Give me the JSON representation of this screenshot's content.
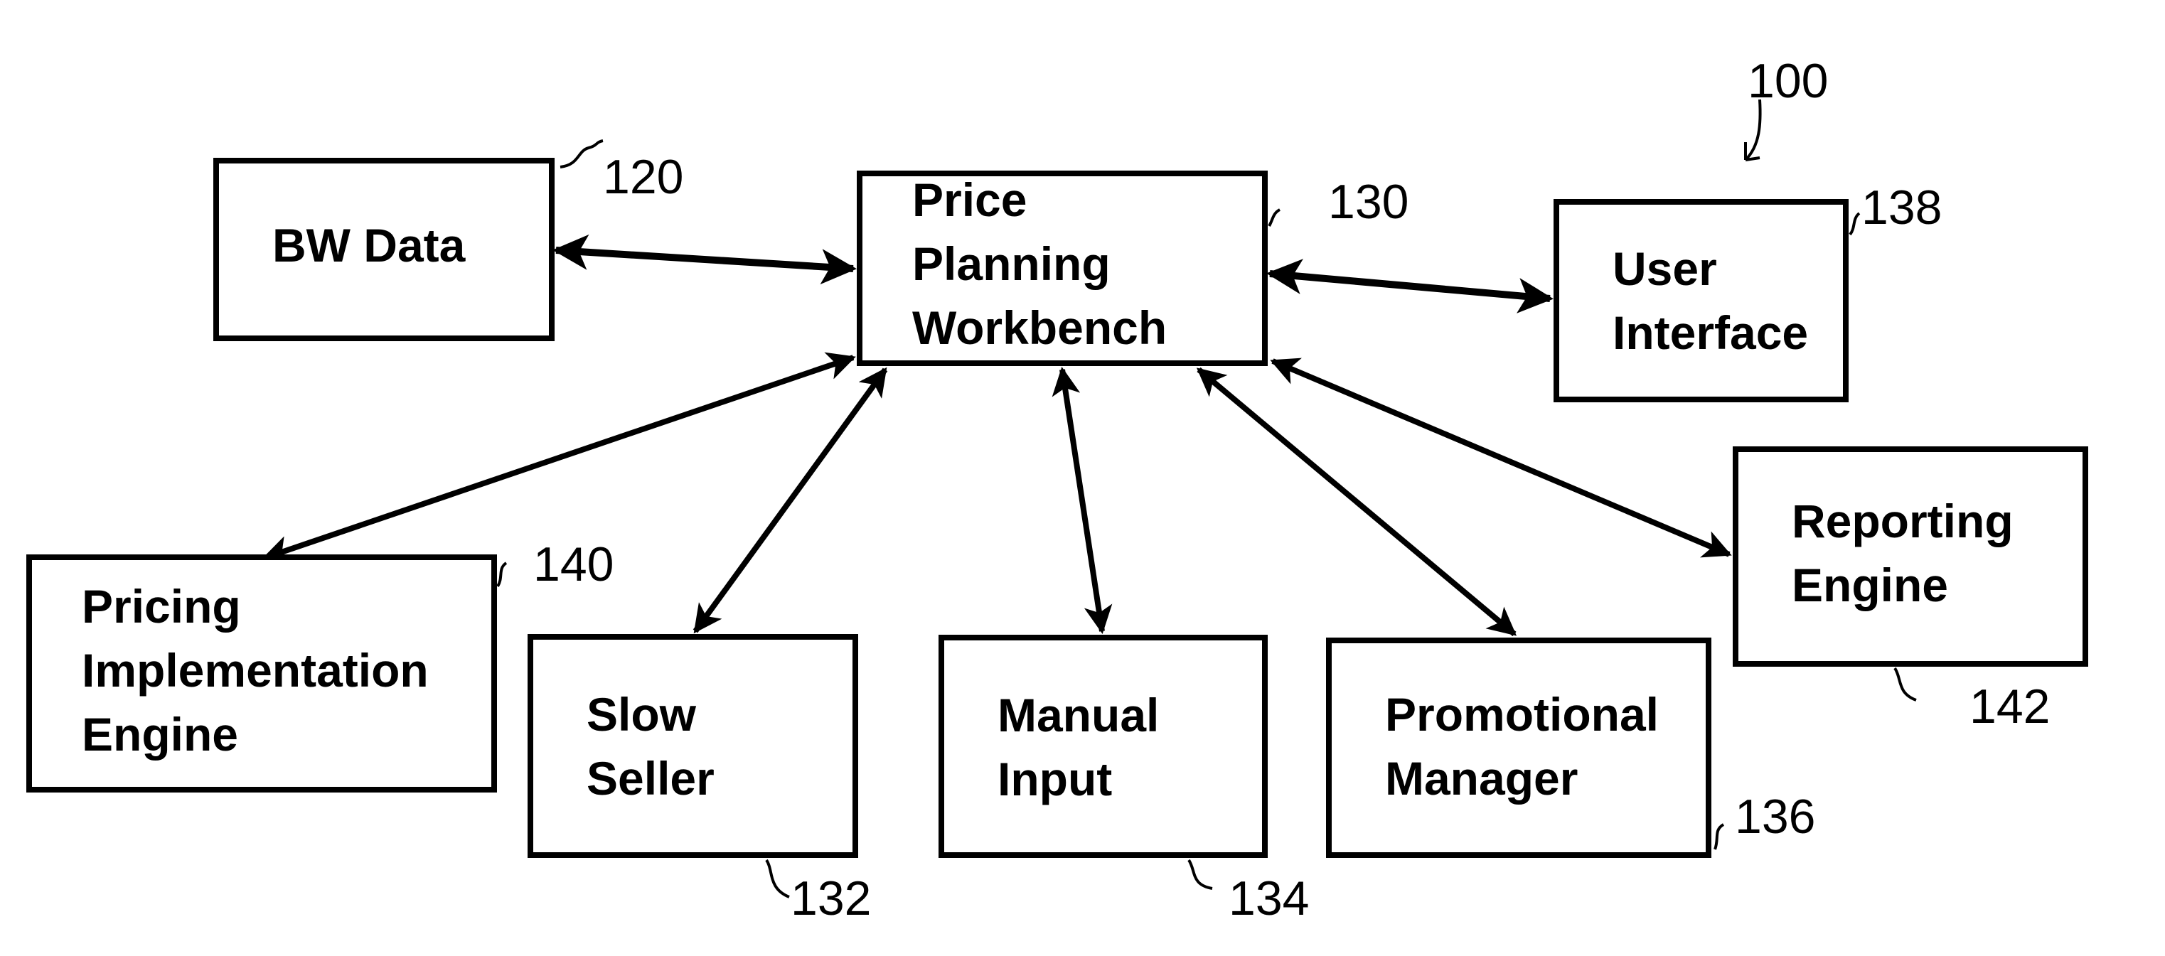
{
  "figure_ref": "100",
  "nodes": {
    "bw_data": {
      "label": "BW Data",
      "ref": "120"
    },
    "workbench": {
      "label": "Price\nPlanning\nWorkbench",
      "ref": "130"
    },
    "user_interface": {
      "label": "User\nInterface",
      "ref": "138"
    },
    "pricing_engine": {
      "label": "Pricing\nImplementation\nEngine",
      "ref": "140"
    },
    "slow_seller": {
      "label": "Slow\nSeller",
      "ref": "132"
    },
    "manual_input": {
      "label": "Manual\nInput",
      "ref": "134"
    },
    "promotional_manager": {
      "label": "Promotional\nManager",
      "ref": "136"
    },
    "reporting_engine": {
      "label": "Reporting\nEngine",
      "ref": "142"
    }
  },
  "edges": [
    {
      "from": "bw_data",
      "to": "workbench",
      "direction": "bidirectional"
    },
    {
      "from": "workbench",
      "to": "user_interface",
      "direction": "bidirectional"
    },
    {
      "from": "workbench",
      "to": "pricing_engine",
      "direction": "bidirectional"
    },
    {
      "from": "workbench",
      "to": "slow_seller",
      "direction": "bidirectional"
    },
    {
      "from": "workbench",
      "to": "manual_input",
      "direction": "bidirectional"
    },
    {
      "from": "workbench",
      "to": "promotional_manager",
      "direction": "bidirectional"
    },
    {
      "from": "workbench",
      "to": "reporting_engine",
      "direction": "bidirectional"
    }
  ]
}
